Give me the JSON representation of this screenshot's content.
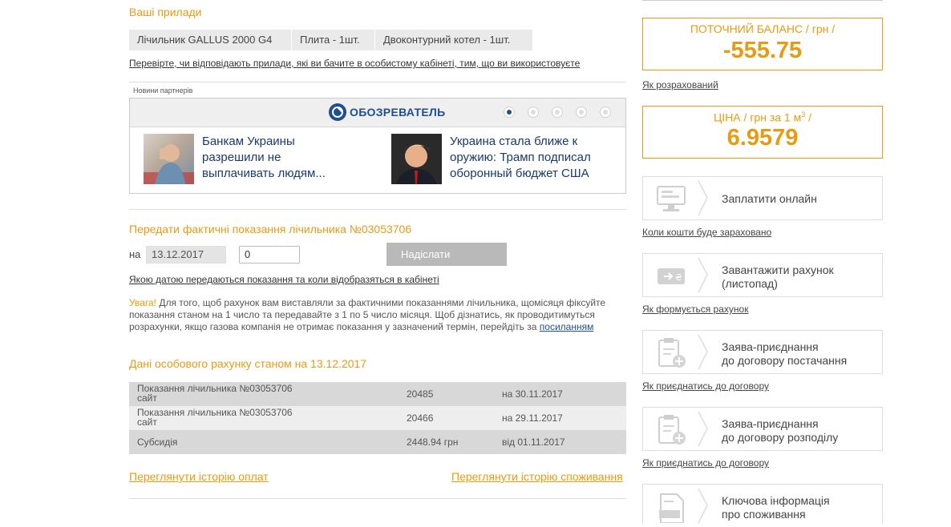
{
  "devices": {
    "title": "Ваші прилади",
    "items": [
      "Лічильник GALLUS 2000 G4",
      "Плита - 1шт.",
      "Двоконтурний котел - 1шт."
    ],
    "check_link": "Перевірте, чи відповідають прилади, які ви бачите в особистому кабінеті, тим, що ви використовуєте"
  },
  "news": {
    "label": "Новини партнерів",
    "brand": "ОБОЗРЕВАТЕЛЬ",
    "items": [
      {
        "title": "Банкам Украины разрешили не выплачивать людям..."
      },
      {
        "title": "Украина стала ближе к оружию: Трамп подписал оборонный бюджет США"
      }
    ]
  },
  "meter": {
    "title": "Передати фактичні показання лічильника №03053706",
    "on_label": "на",
    "date_value": "13.12.2017",
    "reading_value": "0",
    "send_label": "Надіслати",
    "info_link": "Якою датою передаються показання та коли відобразяться в кабінеті",
    "warning_label": "Увага!",
    "warning_text": "Для того, щоб рахунок вам виставляли за фактичними показаннями лічильника, щомісяця фіксуйте показання станом на 1 число та передавайте з 1 по 5 число місяця. Щоб дізнатись, як проводитимуться розрахунки, якщо газова компанія не отримає показання у зазначений термін, перейдіть за",
    "warning_link": "посиланням"
  },
  "account": {
    "title": "Дані особового рахунку станом на 13.12.2017",
    "rows": [
      {
        "label1": "Показання лічильника №03053706",
        "label2": "сайт",
        "value": "20485",
        "date": "на 30.11.2017"
      },
      {
        "label1": "Показання лічильника №03053706",
        "label2": "сайт",
        "value": "20466",
        "date": "на 29.11.2017"
      },
      {
        "label1": "Субсидія",
        "label2": "",
        "value": "2448.94 грн",
        "date": "від 01.11.2017"
      }
    ],
    "history_payments": "Переглянути історію оплат",
    "history_consumption": "Переглянути історію споживання"
  },
  "balance": {
    "label": "ПОТОЧНИЙ БАЛАНС / грн /",
    "value": "-555.75",
    "link": "Як розрахований"
  },
  "price": {
    "label_pre": "ЦІНА / грн за 1 м",
    "label_sup": "3",
    "label_post": " /",
    "value": "6.9579"
  },
  "services": [
    {
      "icon": "monitor-icon",
      "line1": "Заплатити онлайн",
      "line2": "",
      "link": "Коли кошти буде зараховано"
    },
    {
      "icon": "invoice-download-icon",
      "line1": "Завантажити рахунок",
      "line2": "(листопад)",
      "link": "Як формується рахунок"
    },
    {
      "icon": "clipboard-add-icon",
      "line1": "Заява-приєднання",
      "line2": "до договору постачання",
      "link": "Як приєднатись до договору"
    },
    {
      "icon": "clipboard-add-icon",
      "line1": "Заява-приєднання",
      "line2": "до договору розподілу",
      "link": "Як приєднатись до договору"
    },
    {
      "icon": "document-icon",
      "line1": "Ключова інформація",
      "line2": "про споживання",
      "link": ""
    }
  ],
  "colors": {
    "accent": "#e59b12",
    "news_dot_active": "#1e4f8f"
  }
}
